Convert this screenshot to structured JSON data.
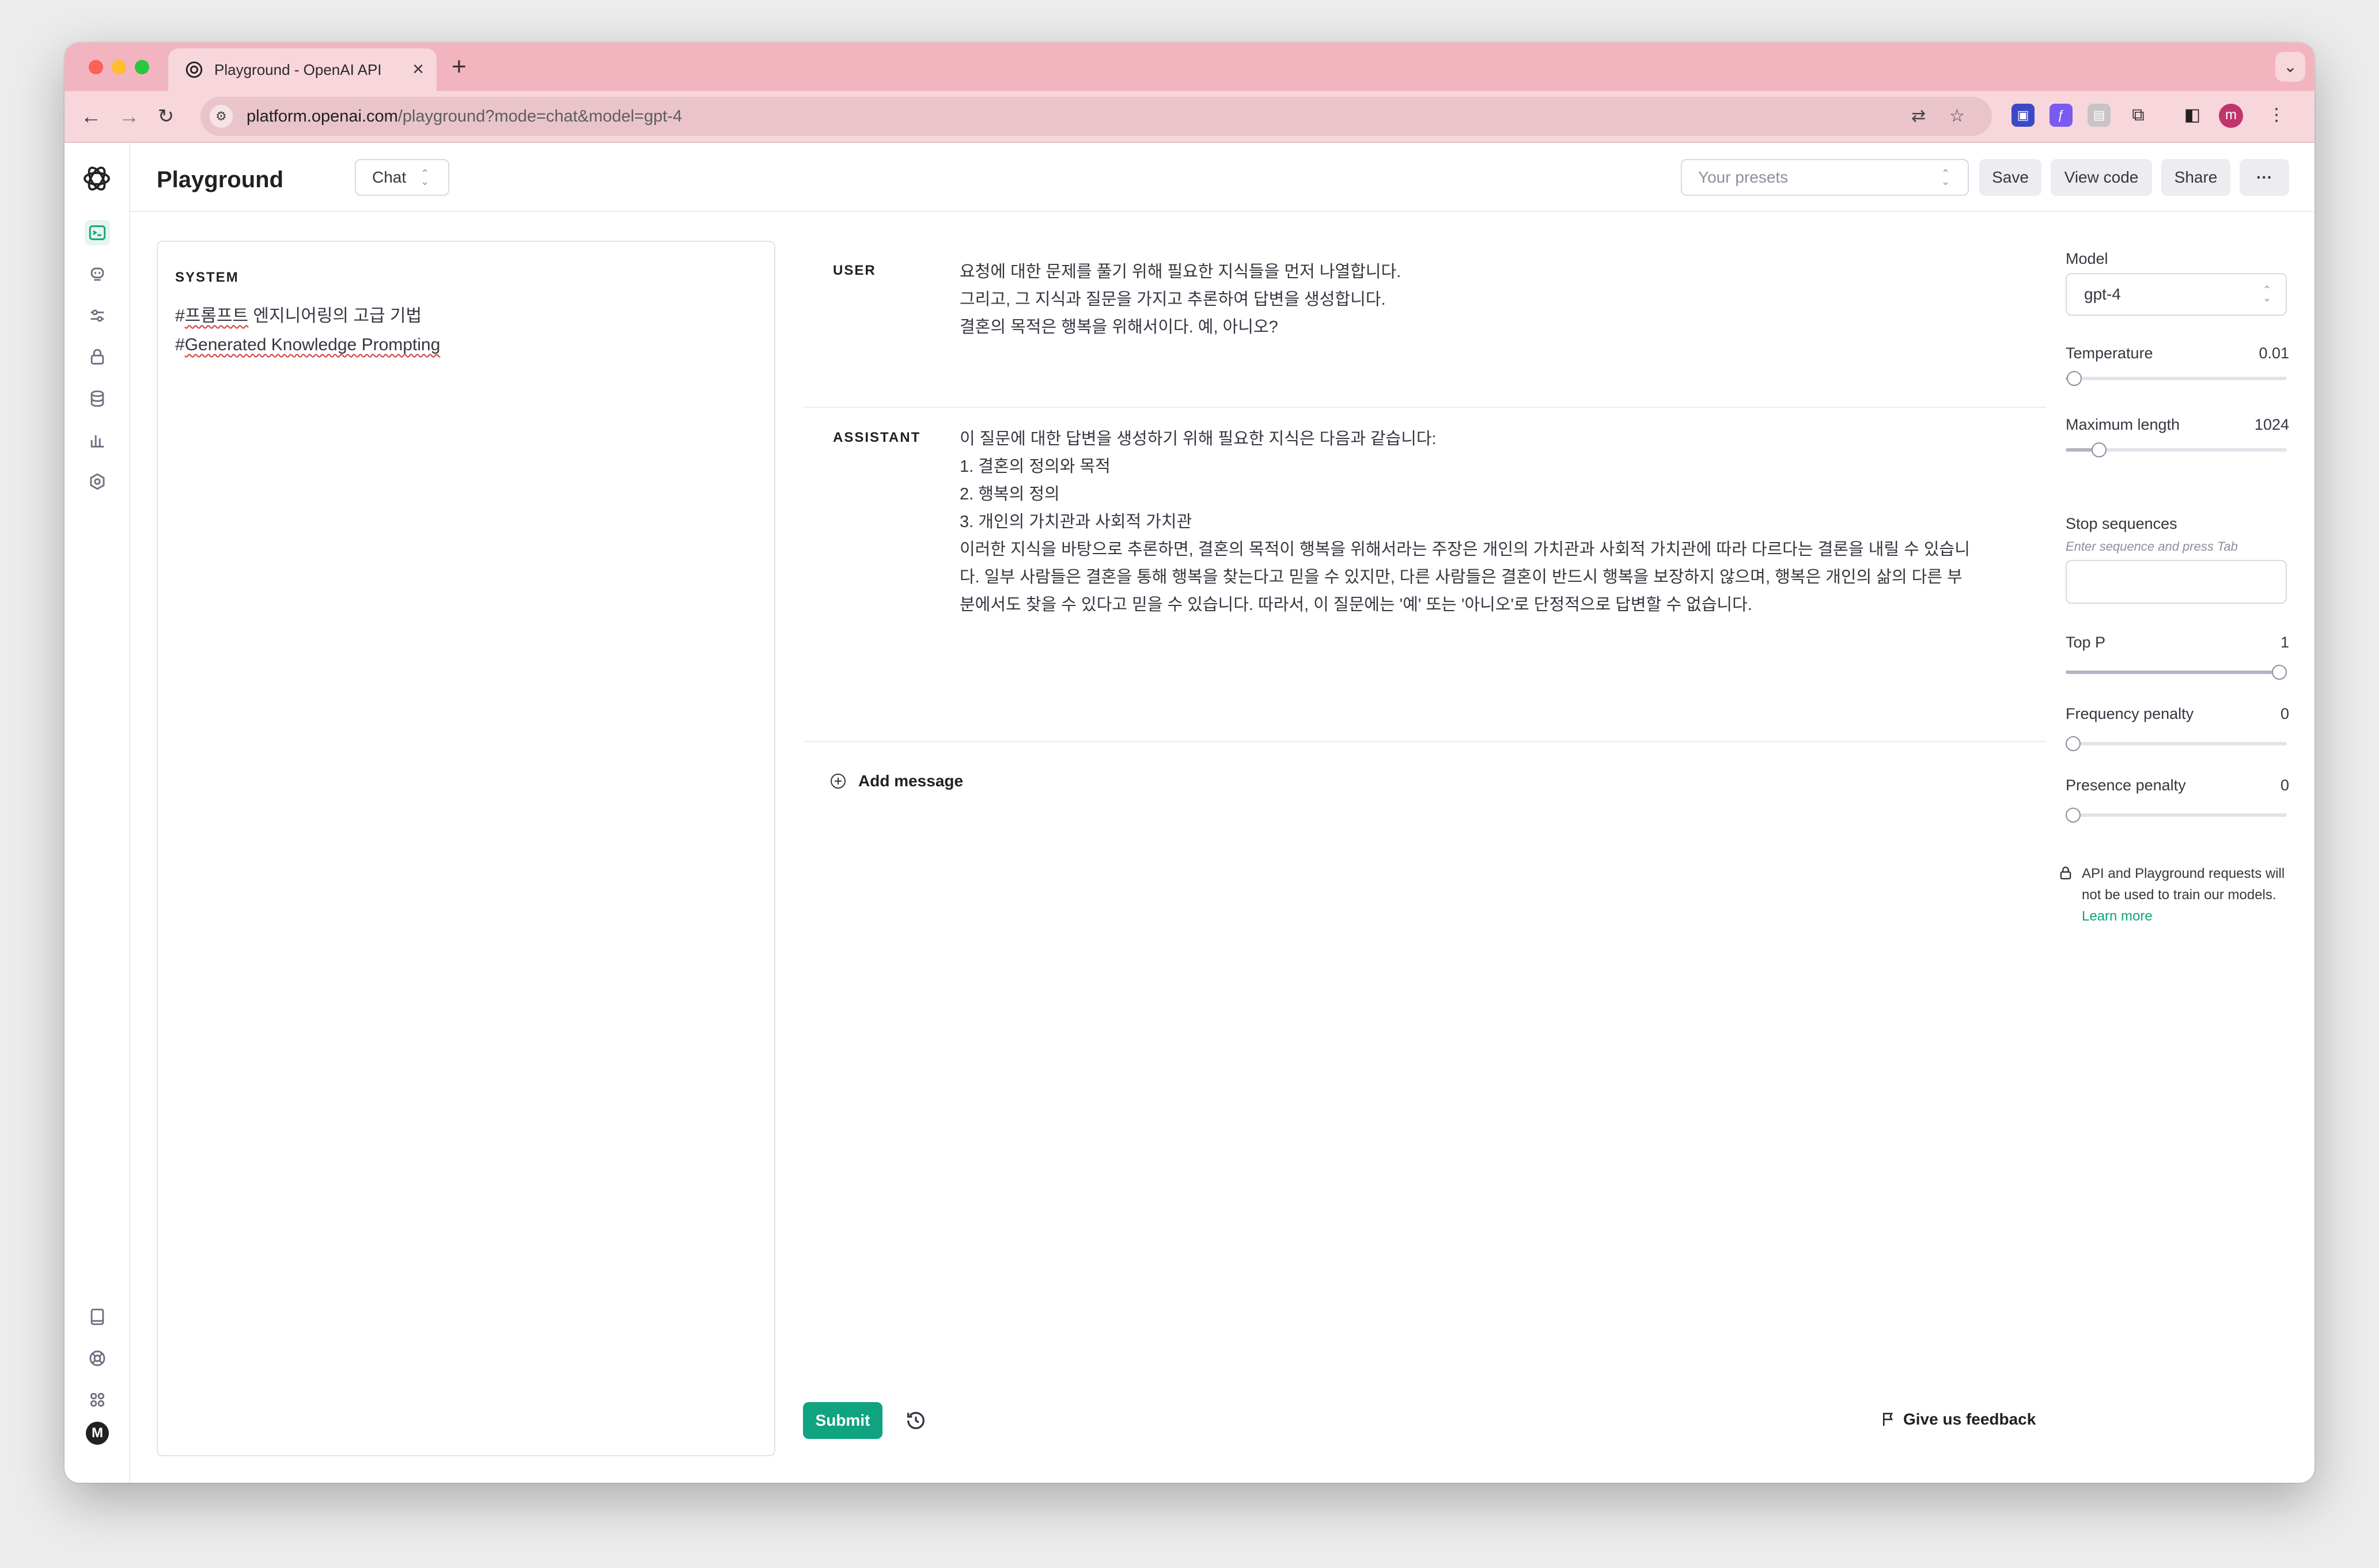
{
  "browser": {
    "tab_title": "Playground - OpenAI API",
    "url_host": "platform.openai.com",
    "url_path": "/playground?mode=chat&model=gpt-4",
    "profile_initial": "m"
  },
  "header": {
    "title": "Playground",
    "mode": "Chat",
    "presets_placeholder": "Your presets",
    "save_label": "Save",
    "view_code_label": "View code",
    "share_label": "Share",
    "more_label": "···"
  },
  "system": {
    "label": "SYSTEM",
    "line1_prefix": "#",
    "line1_word1": "프롬프트",
    "line1_rest": " 엔지니어링의 고급 기법",
    "line2_prefix": "#",
    "line2_text": "Generated Knowledge Prompting"
  },
  "messages": [
    {
      "role": "USER",
      "lines": [
        "요청에 대한 문제를 풀기 위해 필요한 지식들을 먼저 나열합니다.",
        "그리고, 그 지식과 질문을 가지고 추론하여 답변을 생성합니다.",
        "",
        "결혼의 목적은 행복을 위해서이다. 예, 아니오?"
      ]
    },
    {
      "role": "ASSISTANT",
      "lines": [
        "이 질문에 대한 답변을 생성하기 위해 필요한 지식은 다음과 같습니다:",
        "",
        "1. 결혼의 정의와 목적",
        "2. 행복의 정의",
        "3. 개인의 가치관과 사회적 가치관",
        "",
        "이러한 지식을 바탕으로 추론하면, 결혼의 목적이 행복을 위해서라는 주장은 개인의 가치관과 사회적 가치관에 따라 다르다는 결론을 내릴 수 있습니다. 일부 사람들은 결혼을 통해 행복을 찾는다고 믿을 수 있지만, 다른 사람들은 결혼이 반드시 행복을 보장하지 않으며, 행복은 개인의 삶의 다른 부분에서도 찾을 수 있다고 믿을 수 있습니다. 따라서, 이 질문에는 '예' 또는 '아니오'로 단정적으로 답변할 수 없습니다."
      ]
    }
  ],
  "add_message_label": "Add message",
  "submit_label": "Submit",
  "feedback_label": "Give us feedback",
  "settings": {
    "model_label": "Model",
    "model_value": "gpt-4",
    "temperature_label": "Temperature",
    "temperature_value": "0.01",
    "temperature_fraction": 0.005,
    "max_length_label": "Maximum length",
    "max_length_value": "1024",
    "max_length_fraction": 0.125,
    "stop_label": "Stop sequences",
    "stop_hint": "Enter sequence and press Tab",
    "top_p_label": "Top P",
    "top_p_value": "1",
    "top_p_fraction": 1.0,
    "frequency_label": "Frequency penalty",
    "frequency_value": "0",
    "frequency_fraction": 0.0,
    "presence_label": "Presence penalty",
    "presence_value": "0",
    "presence_fraction": 0.0,
    "privacy_text": "API and Playground requests will not be used to train our models.",
    "learn_more": "Learn more"
  },
  "colors": {
    "accent": "#10a37f",
    "tab_bar": "#f2b4bf",
    "toolbar": "#f7d6dc"
  }
}
